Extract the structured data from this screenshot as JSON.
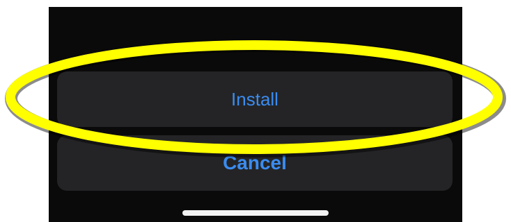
{
  "sheet": {
    "install_label": "Install",
    "cancel_label": "Cancel"
  },
  "colors": {
    "screen_background": "#0a0a0a",
    "button_background": "#242426",
    "button_text": "#3a8cf0",
    "highlight": "#ffff00",
    "home_indicator": "#f2f2f2"
  }
}
